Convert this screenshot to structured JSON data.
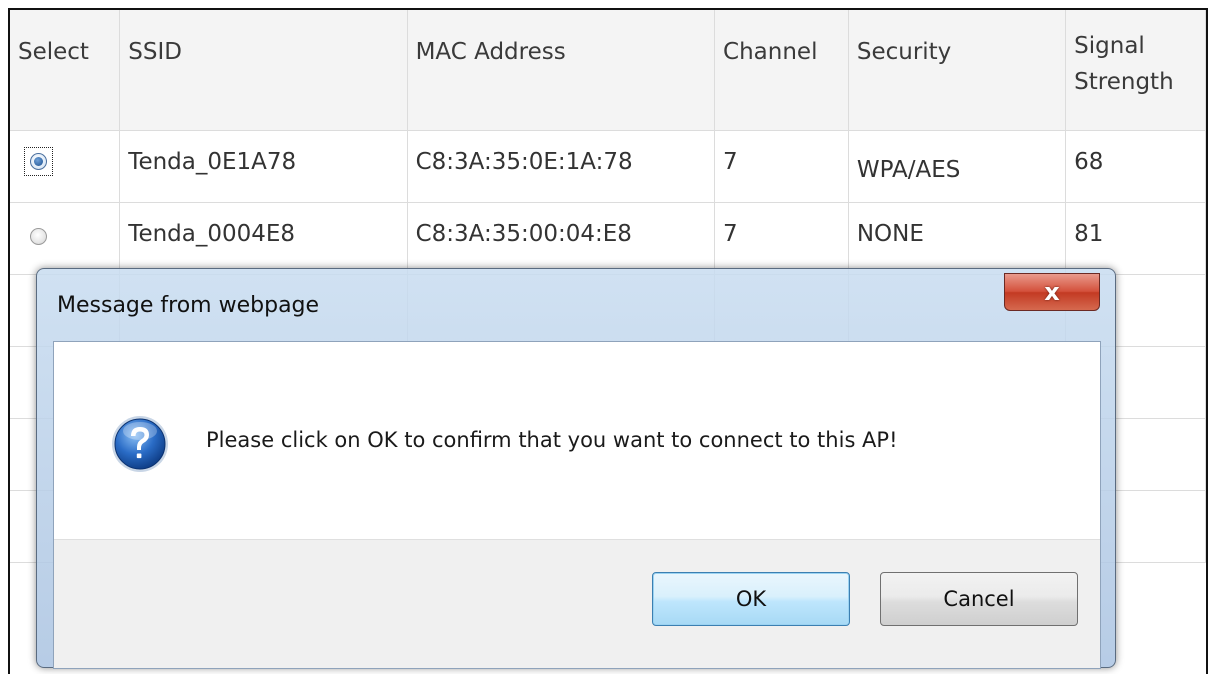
{
  "table": {
    "headers": [
      "Select",
      "SSID",
      "MAC Address",
      "Channel",
      "Security",
      "Signal Strength"
    ],
    "rows": [
      {
        "ssid": "Tenda_0E1A78",
        "mac": "C8:3A:35:0E:1A:78",
        "channel": "7",
        "security": "WPA/AES",
        "signal": "68",
        "selected": true
      },
      {
        "ssid": "Tenda_0004E8",
        "mac": "C8:3A:35:00:04:E8",
        "channel": "7",
        "security": "NONE",
        "signal": "81",
        "selected": false
      }
    ]
  },
  "dialog": {
    "title": "Message from webpage",
    "close_label": "x",
    "message": "Please click on OK to confirm that you want to connect to this AP!",
    "ok_label": "OK",
    "cancel_label": "Cancel",
    "icon": "question-icon"
  },
  "colors": {
    "close_button": "#c8442d",
    "ok_button_border": "#3c7fb1",
    "question_icon": "#1f5fb4"
  }
}
